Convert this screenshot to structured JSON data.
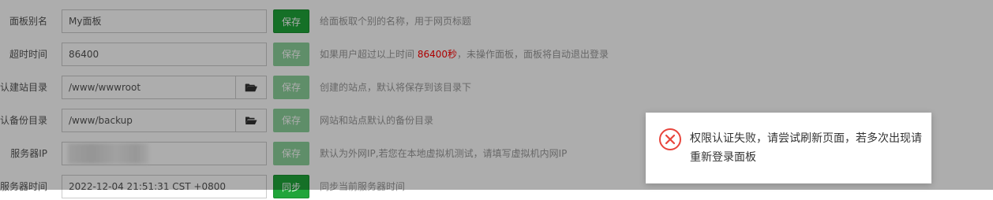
{
  "settings": {
    "rows": [
      {
        "label": "面板别名",
        "value": "My面板",
        "button": "保存",
        "hint": "给面板取个别的名称，用于网页标题"
      },
      {
        "label": "超时时间",
        "value": "86400",
        "button": "保存",
        "hint_before": "如果用户超过以上时间 ",
        "hint_highlight": "86400秒",
        "hint_after": "，未操作面板，面板将自动退出登录"
      },
      {
        "label": "默认建站目录",
        "value": "/www/wwwroot",
        "button": "保存",
        "hint": "创建的站点，默认将保存到该目录下"
      },
      {
        "label": "默认备份目录",
        "value": "/www/backup",
        "button": "保存",
        "hint": "网站和站点默认的备份目录"
      },
      {
        "label": "服务器IP",
        "value": "",
        "button": "保存",
        "hint": "默认为外网IP,若您在本地虚拟机测试，请填写虚拟机内网IP"
      },
      {
        "label": "服务器时间",
        "value": "2022-12-04 21:51:31 CST +0800",
        "button": "同步",
        "hint": "同步当前服务器时间"
      }
    ]
  },
  "toast": {
    "icon": "error-circle-icon",
    "message": "权限认证失败，请尝试刷新页面，若多次出现请重新登录面板"
  },
  "colors": {
    "accent": "#20a53a",
    "accent_disabled": "#8dd19b",
    "error": "#e8453c",
    "highlight": "#ff0000"
  }
}
